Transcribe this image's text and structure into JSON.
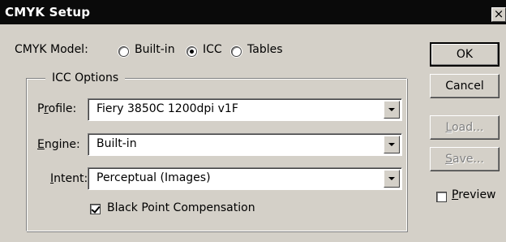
{
  "window": {
    "title": "CMYK Setup",
    "close_glyph": "×"
  },
  "cmyk_model": {
    "label": "CMYK Model:",
    "options": [
      {
        "label": "Built-in",
        "selected": false
      },
      {
        "label": "ICC",
        "selected": true
      },
      {
        "label": "Tables",
        "selected": false
      }
    ]
  },
  "icc_options": {
    "legend": "ICC Options",
    "profile": {
      "label_prefix": "P",
      "label_accel": "r",
      "label_rest": "ofile:",
      "value": "Fiery 3850C 1200dpi v1F"
    },
    "engine": {
      "label_accel": "E",
      "label_rest": "ngine:",
      "value": "Built-in"
    },
    "intent": {
      "label_accel": "I",
      "label_rest": "ntent:",
      "value": "Perceptual (Images)"
    },
    "black_point": {
      "label": "Black Point Compensation",
      "checked": true
    }
  },
  "buttons": {
    "ok": "OK",
    "cancel": "Cancel",
    "load_accel": "L",
    "load_rest": "oad...",
    "save_accel": "S",
    "save_rest": "ave..."
  },
  "preview": {
    "label_accel": "P",
    "label_rest": "review",
    "checked": false
  },
  "icons": {
    "close": "close-icon",
    "dropdown": "chevron-down-icon",
    "check": "check-icon"
  }
}
